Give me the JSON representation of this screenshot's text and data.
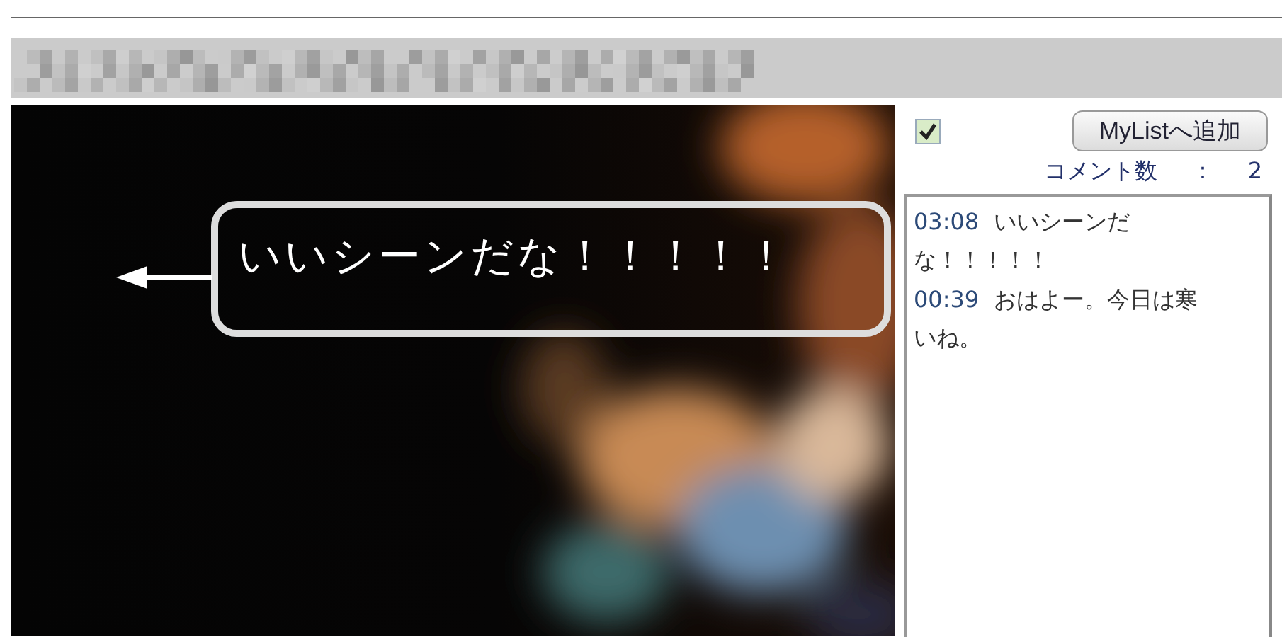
{
  "video": {
    "kind": "picture",
    "overlay_comment": "いいシーンだな！！！！！"
  },
  "sidebar": {
    "checkbox": {
      "checked": true
    },
    "mylist_button": "MyListへ追加",
    "comment_count_label": "コメント数",
    "comment_count_separator": "：",
    "comment_count": "2",
    "comments": [
      {
        "time": "03:08",
        "text": "いいシーンだな！！！！！"
      },
      {
        "time": "00:39",
        "text": "おはよー。今日は寒いね。"
      }
    ]
  }
}
